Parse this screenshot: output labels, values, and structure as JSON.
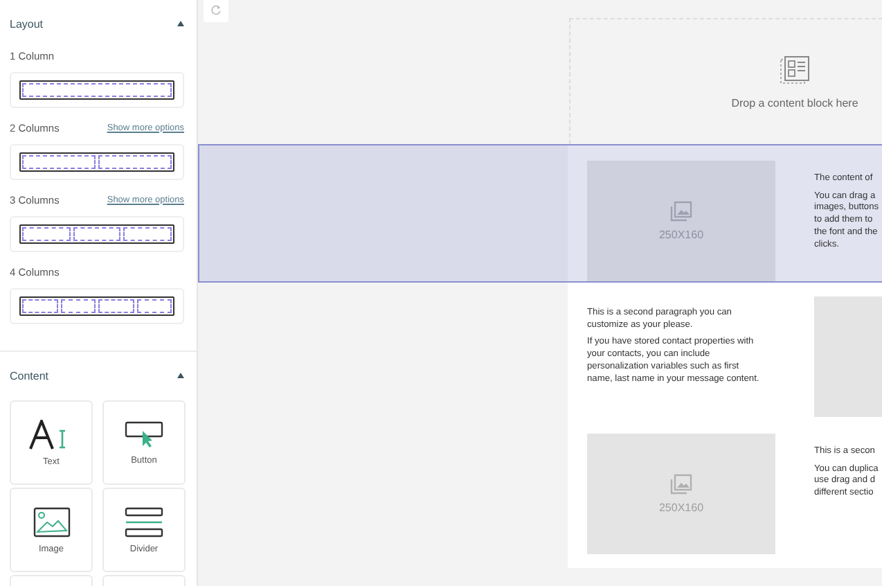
{
  "sidebar": {
    "sections": [
      {
        "title": "Layout",
        "expanded": true,
        "kind": "layout",
        "options": [
          {
            "label": "1 Column",
            "kind": "one"
          },
          {
            "label": "2 Columns",
            "link": "Show more options",
            "kind": "two"
          },
          {
            "label": "3 Columns",
            "link": "Show more options",
            "kind": "three"
          },
          {
            "label": "4 Columns",
            "kind": "four"
          }
        ]
      },
      {
        "title": "Content",
        "expanded": true,
        "kind": "content",
        "blocks": [
          {
            "label": "Text",
            "kind": "text"
          },
          {
            "label": "Button",
            "kind": "button"
          },
          {
            "label": "Image",
            "kind": "image"
          },
          {
            "label": "Divider",
            "kind": "divider"
          },
          {
            "kind": "blank"
          },
          {
            "kind": "blank"
          }
        ]
      }
    ]
  },
  "canvas": {
    "drop_zone": {
      "text": "Drop a content block here"
    },
    "rows": [
      {
        "selected": true,
        "cells": [
          {
            "kind": "picture",
            "caption": "250X160"
          },
          {
            "kind": "text",
            "paragraphs": [
              "The content of",
              "You can drag a\nimages, buttons\nto add them to\nthe font and the\nclicks."
            ]
          }
        ]
      },
      {
        "selected": false,
        "cells": [
          {
            "kind": "text",
            "paragraphs": [
              "This is a second paragraph you can\ncustomize as your please.",
              "If you have stored contact properties with\nyour contacts, you can include\npersonalization variables such as first\nname, last name in your message content."
            ]
          },
          {
            "kind": "picture"
          }
        ]
      },
      {
        "selected": false,
        "cells": [
          {
            "kind": "picture",
            "caption": "250X160"
          },
          {
            "kind": "text",
            "paragraphs": [
              "This is a secon",
              "You can duplica\nuse drag and d\ndifferent sectio"
            ]
          }
        ]
      }
    ]
  }
}
